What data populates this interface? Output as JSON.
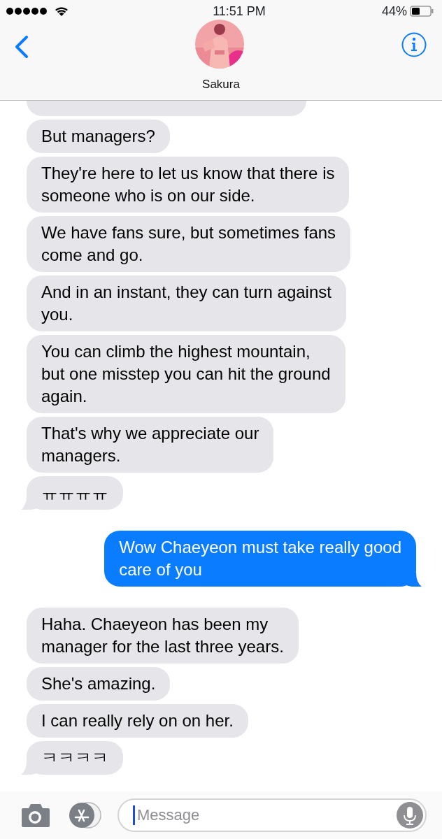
{
  "status_bar": {
    "time": "11:51 PM",
    "battery": "44%"
  },
  "header": {
    "contact_name": "Sakura"
  },
  "messages": [
    {
      "kind": "received",
      "tail": false
    },
    {
      "kind": "received",
      "tail": false,
      "lines": [
        "But managers?"
      ]
    },
    {
      "kind": "received",
      "tail": false,
      "lines": [
        "They're here to let us know that there is",
        "someone who is on our side."
      ]
    },
    {
      "kind": "received",
      "tail": false,
      "lines": [
        "We have fans sure, but sometimes fans",
        "come and go."
      ]
    },
    {
      "kind": "received",
      "tail": false,
      "lines": [
        "And in an instant, they can turn against",
        "you."
      ]
    },
    {
      "kind": "received",
      "tail": false,
      "lines": [
        "You can climb the highest mountain,",
        "but one misstep you can hit the ground",
        "again."
      ]
    },
    {
      "kind": "received",
      "tail": false,
      "lines": [
        "That's why we appreciate our",
        "managers."
      ]
    },
    {
      "kind": "received",
      "tail": true,
      "lines": [
        "ㅠㅠㅠㅠ"
      ]
    },
    {
      "kind": "sent",
      "tail": true,
      "lines": [
        "Wow Chaeyeon must take really good",
        "care of you"
      ]
    },
    {
      "kind": "received",
      "tail": false,
      "lines": [
        "Haha. Chaeyeon has been my",
        "manager for the last three years."
      ]
    },
    {
      "kind": "received",
      "tail": false,
      "lines": [
        "She's amazing."
      ]
    },
    {
      "kind": "received",
      "tail": false,
      "lines": [
        "I can really rely on on her."
      ]
    },
    {
      "kind": "received",
      "tail": true,
      "lines": [
        "ㅋㅋㅋㅋ"
      ]
    }
  ],
  "composer": {
    "placeholder": "Message"
  }
}
